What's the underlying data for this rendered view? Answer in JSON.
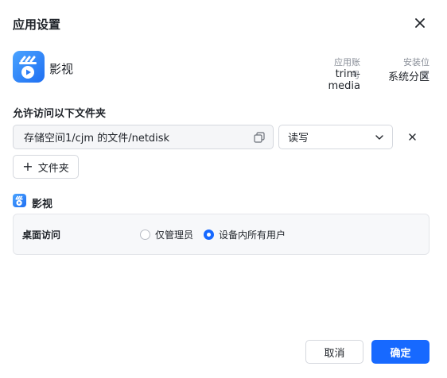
{
  "dialog": {
    "title": "应用设置",
    "close_icon": "close-icon"
  },
  "app": {
    "name": "影视",
    "icon": "film-play-icon",
    "account_label": "应用账号",
    "account_value": "trim-media",
    "location_label": "安装位置",
    "location_value": "系统分区"
  },
  "folders": {
    "section_title": "允许访问以下文件夹",
    "path": "存储空间1/cjm 的文件/netdisk",
    "permission": "读写",
    "add_label": "文件夹"
  },
  "access": {
    "app_name": "影视",
    "row_label": "桌面访问",
    "options": [
      {
        "label": "仅管理员",
        "selected": false
      },
      {
        "label": "设备内所有用户",
        "selected": true
      }
    ]
  },
  "footer": {
    "cancel_label": "取消",
    "ok_label": "确定"
  },
  "colors": {
    "accent": "#1769ff",
    "border": "#d5d8de"
  }
}
